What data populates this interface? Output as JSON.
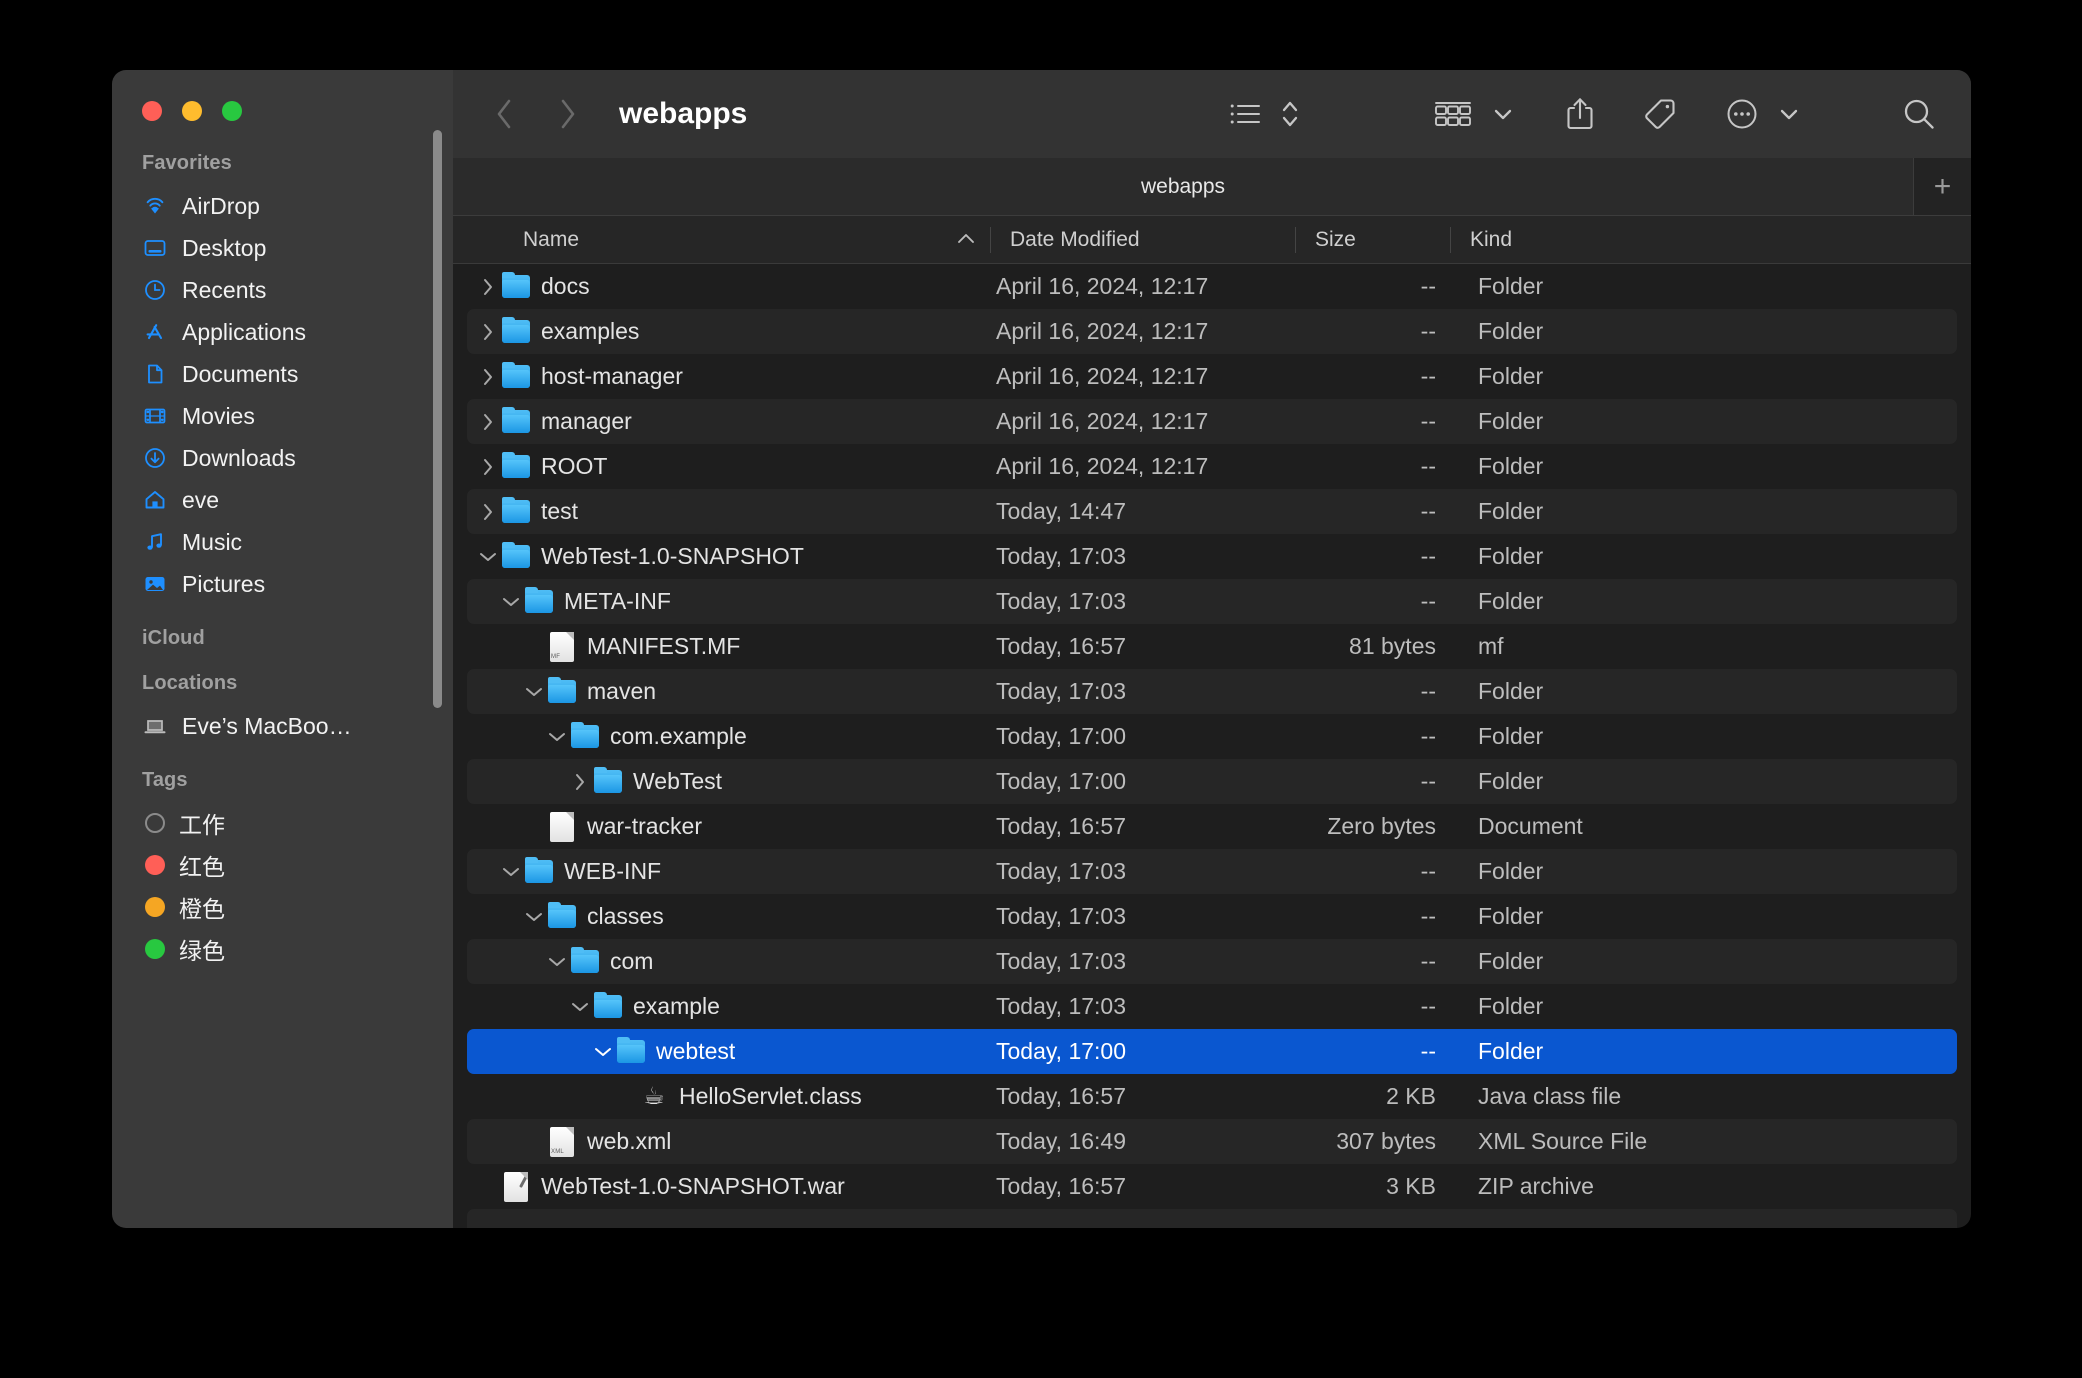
{
  "window": {
    "title": "webapps",
    "traffic_lights": [
      "close-red",
      "minimize-yellow",
      "zoom-green"
    ]
  },
  "toolbar": {
    "back_icon": "chevron-left-icon",
    "forward_icon": "chevron-right-icon",
    "title": "webapps",
    "view_icon": "list-view-icon",
    "sort_icon": "sort-updown-icon",
    "group_icon": "group-by-icon",
    "group_chevron": "chevron-down-icon",
    "share_icon": "share-icon",
    "tag_icon": "tag-icon",
    "more_icon": "more-ellipsis-icon",
    "more_chevron": "chevron-down-icon",
    "search_icon": "search-icon"
  },
  "tabs": {
    "items": [
      {
        "label": "webapps",
        "active": true
      }
    ],
    "new_tab_label": "+"
  },
  "columns": {
    "name": "Name",
    "date_modified": "Date Modified",
    "size": "Size",
    "kind": "Kind",
    "sort_caret": "⌃",
    "sort_column": "Name",
    "sort_direction": "ascending"
  },
  "files": [
    {
      "name": "docs",
      "date": "April 16, 2024, 12:17",
      "size": "--",
      "kind": "Folder",
      "depth": 0,
      "icon": "folder-icon",
      "twisty": "collapsed",
      "selected": false
    },
    {
      "name": "examples",
      "date": "April 16, 2024, 12:17",
      "size": "--",
      "kind": "Folder",
      "depth": 0,
      "icon": "folder-icon",
      "twisty": "collapsed",
      "selected": false
    },
    {
      "name": "host-manager",
      "date": "April 16, 2024, 12:17",
      "size": "--",
      "kind": "Folder",
      "depth": 0,
      "icon": "folder-icon",
      "twisty": "collapsed",
      "selected": false
    },
    {
      "name": "manager",
      "date": "April 16, 2024, 12:17",
      "size": "--",
      "kind": "Folder",
      "depth": 0,
      "icon": "folder-icon",
      "twisty": "collapsed",
      "selected": false
    },
    {
      "name": "ROOT",
      "date": "April 16, 2024, 12:17",
      "size": "--",
      "kind": "Folder",
      "depth": 0,
      "icon": "folder-icon",
      "twisty": "collapsed",
      "selected": false
    },
    {
      "name": "test",
      "date": "Today, 14:47",
      "size": "--",
      "kind": "Folder",
      "depth": 0,
      "icon": "folder-icon",
      "twisty": "collapsed",
      "selected": false
    },
    {
      "name": "WebTest-1.0-SNAPSHOT",
      "date": "Today, 17:03",
      "size": "--",
      "kind": "Folder",
      "depth": 0,
      "icon": "folder-icon",
      "twisty": "expanded",
      "selected": false
    },
    {
      "name": "META-INF",
      "date": "Today, 17:03",
      "size": "--",
      "kind": "Folder",
      "depth": 1,
      "icon": "folder-icon",
      "twisty": "expanded",
      "selected": false
    },
    {
      "name": "MANIFEST.MF",
      "date": "Today, 16:57",
      "size": "81 bytes",
      "kind": "mf",
      "depth": 2,
      "icon": "document-mf-icon",
      "twisty": "none",
      "selected": false
    },
    {
      "name": "maven",
      "date": "Today, 17:03",
      "size": "--",
      "kind": "Folder",
      "depth": 2,
      "icon": "folder-icon",
      "twisty": "expanded",
      "selected": false
    },
    {
      "name": "com.example",
      "date": "Today, 17:00",
      "size": "--",
      "kind": "Folder",
      "depth": 3,
      "icon": "folder-icon",
      "twisty": "expanded",
      "selected": false
    },
    {
      "name": "WebTest",
      "date": "Today, 17:00",
      "size": "--",
      "kind": "Folder",
      "depth": 4,
      "icon": "folder-icon",
      "twisty": "collapsed",
      "selected": false
    },
    {
      "name": "war-tracker",
      "date": "Today, 16:57",
      "size": "Zero bytes",
      "kind": "Document",
      "depth": 2,
      "icon": "document-icon",
      "twisty": "none",
      "selected": false
    },
    {
      "name": "WEB-INF",
      "date": "Today, 17:03",
      "size": "--",
      "kind": "Folder",
      "depth": 1,
      "icon": "folder-icon",
      "twisty": "expanded",
      "selected": false
    },
    {
      "name": "classes",
      "date": "Today, 17:03",
      "size": "--",
      "kind": "Folder",
      "depth": 2,
      "icon": "folder-icon",
      "twisty": "expanded",
      "selected": false
    },
    {
      "name": "com",
      "date": "Today, 17:03",
      "size": "--",
      "kind": "Folder",
      "depth": 3,
      "icon": "folder-icon",
      "twisty": "expanded",
      "selected": false
    },
    {
      "name": "example",
      "date": "Today, 17:03",
      "size": "--",
      "kind": "Folder",
      "depth": 4,
      "icon": "folder-icon",
      "twisty": "expanded",
      "selected": false
    },
    {
      "name": "webtest",
      "date": "Today, 17:00",
      "size": "--",
      "kind": "Folder",
      "depth": 5,
      "icon": "folder-icon",
      "twisty": "expanded",
      "selected": true
    },
    {
      "name": "HelloServlet.class",
      "date": "Today, 16:57",
      "size": "2 KB",
      "kind": "Java class file",
      "depth": 6,
      "icon": "java-class-icon",
      "twisty": "none",
      "selected": false
    },
    {
      "name": "web.xml",
      "date": "Today, 16:49",
      "size": "307 bytes",
      "kind": "XML Source File",
      "depth": 2,
      "icon": "document-xml-icon",
      "twisty": "none",
      "selected": false
    },
    {
      "name": "WebTest-1.0-SNAPSHOT.war",
      "date": "Today, 16:57",
      "size": "3 KB",
      "kind": "ZIP archive",
      "depth": 0,
      "icon": "archive-icon",
      "twisty": "none",
      "selected": false
    }
  ],
  "sidebar": {
    "sections": [
      {
        "title": "Favorites",
        "items": [
          {
            "label": "AirDrop",
            "icon": "airdrop-icon"
          },
          {
            "label": "Desktop",
            "icon": "desktop-icon"
          },
          {
            "label": "Recents",
            "icon": "clock-icon"
          },
          {
            "label": "Applications",
            "icon": "applications-icon"
          },
          {
            "label": "Documents",
            "icon": "document-icon"
          },
          {
            "label": "Movies",
            "icon": "film-icon"
          },
          {
            "label": "Downloads",
            "icon": "download-icon"
          },
          {
            "label": "eve",
            "icon": "home-icon"
          },
          {
            "label": "Music",
            "icon": "music-note-icon"
          },
          {
            "label": "Pictures",
            "icon": "photo-icon"
          }
        ]
      },
      {
        "title": "iCloud",
        "items": []
      },
      {
        "title": "Locations",
        "items": [
          {
            "label": "Eve’s MacBoo…",
            "icon": "laptop-icon"
          }
        ]
      },
      {
        "title": "Tags",
        "items": [
          {
            "label": "工作",
            "icon": "tag-dot-hollow",
            "color": "transparent"
          },
          {
            "label": "红色",
            "icon": "tag-dot",
            "color": "#ff5f57"
          },
          {
            "label": "橙色",
            "icon": "tag-dot",
            "color": "#f5a623"
          },
          {
            "label": "绿色",
            "icon": "tag-dot",
            "color": "#28c840"
          }
        ]
      }
    ]
  },
  "colors": {
    "accent": "#0a57d0",
    "sidebar_bg": "#3a3a3a",
    "main_bg": "#1e1e1e",
    "toolbar_bg": "#333333",
    "folder_blue": "#2aa3ec"
  }
}
